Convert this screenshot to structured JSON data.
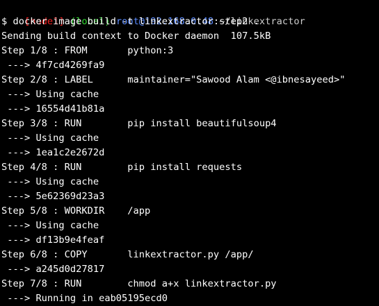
{
  "colors": {
    "background": "#000000",
    "text": "#ffffff",
    "node_tag": "#ee2222",
    "local_tag": "#33dd33",
    "host": "#5c8cff",
    "path": "#cccccc"
  },
  "prompt": {
    "node": "[node1]",
    "local": "(local)",
    "host": "root@192.168.0.48",
    "path": "~/linkextractor"
  },
  "command": "$ docker image build -t linkextractor:step2 .",
  "output": [
    "Sending build context to Docker daemon  107.5kB",
    "Step 1/8 : FROM       python:3",
    " ---> 4f7cd4269fa9",
    "Step 2/8 : LABEL      maintainer=\"Sawood Alam <@ibnesayeed>\"",
    " ---> Using cache",
    " ---> 16554d41b81a",
    "Step 3/8 : RUN        pip install beautifulsoup4",
    " ---> Using cache",
    " ---> 1ea1c2e2672d",
    "Step 4/8 : RUN        pip install requests",
    " ---> Using cache",
    " ---> 5e62369d23a3",
    "Step 5/8 : WORKDIR    /app",
    " ---> Using cache",
    " ---> df13b9e4feaf",
    "Step 6/8 : COPY       linkextractor.py /app/",
    " ---> a245d0d27817",
    "Step 7/8 : RUN        chmod a+x linkextractor.py",
    " ---> Running in eab05195ecd0"
  ]
}
